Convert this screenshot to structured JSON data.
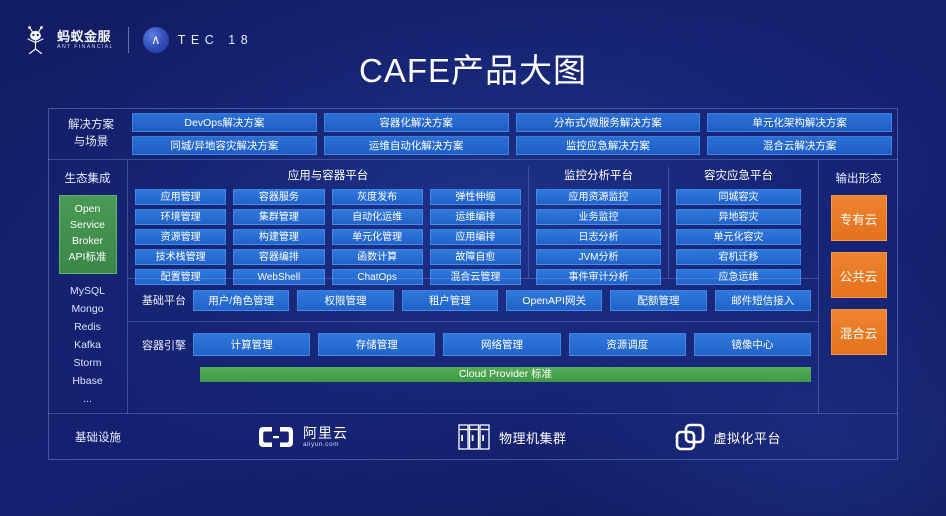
{
  "header": {
    "brand_cn": "蚂蚁金服",
    "brand_en": "ANT FINANCIAL",
    "atec_mark": "∧",
    "atec_text": "TEC 18"
  },
  "title": "CAFE产品大图",
  "solutions": {
    "label": "解决方案\n与场景",
    "label_line1": "解决方案",
    "label_line2": "与场景",
    "row1": [
      "DevOps解决方案",
      "容器化解决方案",
      "分布式/微服务解决方案",
      "单元化架构解决方案"
    ],
    "row2": [
      "同城/异地容灾解决方案",
      "运维自动化解决方案",
      "监控应急解决方案",
      "混合云解决方案"
    ]
  },
  "ecosystem": {
    "title": "生态集成",
    "green_box": [
      "Open",
      "Service",
      "Broker",
      "API标准"
    ],
    "items": [
      "MySQL",
      "Mongo",
      "Redis",
      "Kafka",
      "Storm",
      "Hbase",
      "..."
    ]
  },
  "platforms": [
    {
      "name": "app-container-platform",
      "title": "应用与容器平台",
      "columns": [
        [
          "应用管理",
          "环境管理",
          "资源管理",
          "技术栈管理",
          "配置管理"
        ],
        [
          "容器服务",
          "集群管理",
          "构建管理",
          "容器编排",
          "WebShell"
        ],
        [
          "灰度发布",
          "自动化运维",
          "单元化管理",
          "函数计算",
          "ChatOps"
        ],
        [
          "弹性伸缩",
          "运维编排",
          "应用编排",
          "故障自愈",
          "混合云管理"
        ]
      ]
    },
    {
      "name": "monitoring-analysis-platform",
      "title": "监控分析平台",
      "columns": [
        [
          "应用资源监控",
          "业务监控",
          "日志分析",
          "JVM分析",
          "事件审计分析"
        ]
      ]
    },
    {
      "name": "disaster-recovery-platform",
      "title": "容灾应急平台",
      "columns": [
        [
          "同城容灾",
          "异地容灾",
          "单元化容灾",
          "宕机迁移",
          "应急运维"
        ]
      ]
    }
  ],
  "base_platform": {
    "label": "基础平台",
    "items": [
      "用户/角色管理",
      "权限管理",
      "租户管理",
      "OpenAPI网关",
      "配额管理",
      "邮件短信接入"
    ]
  },
  "container_engine": {
    "label": "容器引擎",
    "items": [
      "计算管理",
      "存储管理",
      "网络管理",
      "资源调度",
      "镜像中心"
    ],
    "standard_bar": "Cloud Provider 标准"
  },
  "output": {
    "title": "输出形态",
    "items": [
      "专有云",
      "公共云",
      "混合云"
    ]
  },
  "infrastructure": {
    "label": "基础设施",
    "aliyun_cn": "阿里云",
    "aliyun_en": "aliyun.com",
    "physical": "物理机集群",
    "virtual": "虚拟化平台"
  },
  "colors": {
    "background": "#15216e",
    "tile_blue": "#2263c8",
    "accent_green": "#3f9a46",
    "accent_orange": "#e4731d"
  }
}
